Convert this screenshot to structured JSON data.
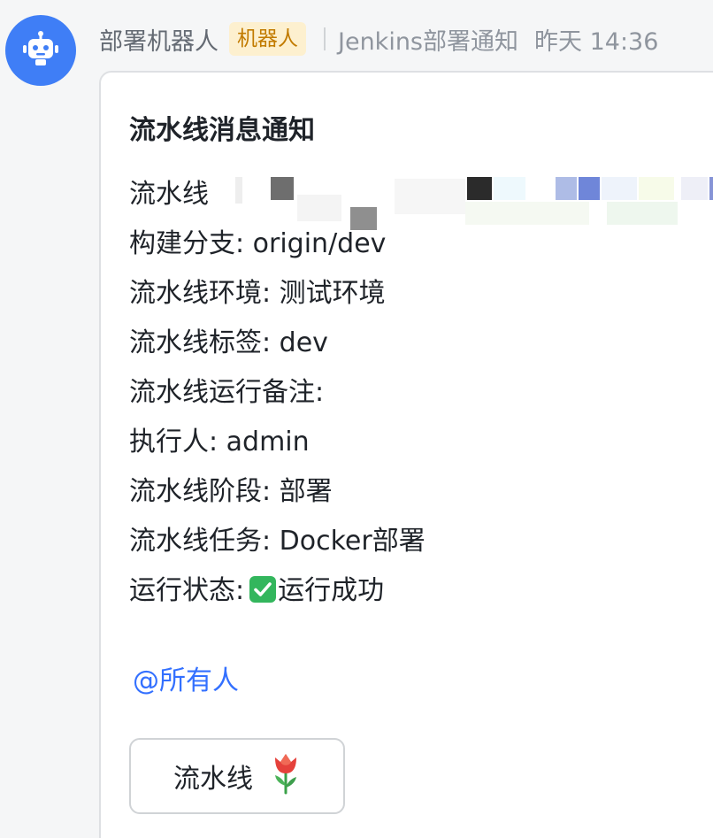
{
  "message": {
    "sender": "部署机器人",
    "badge": "机器人",
    "source": "Jenkins部署通知",
    "time": "昨天 14:36"
  },
  "card": {
    "title": "流水线消息通知",
    "pipeline_label": "流水线",
    "fields": [
      {
        "label": "构建分支",
        "value": "origin/dev"
      },
      {
        "label": "流水线环境",
        "value": "测试环境"
      },
      {
        "label": "流水线标签",
        "value": "dev"
      },
      {
        "label": "流水线运行备注",
        "value": ""
      },
      {
        "label": "执行人",
        "value": "admin"
      },
      {
        "label": "流水线阶段",
        "value": "部署"
      },
      {
        "label": "流水线任务",
        "value": "Docker部署"
      },
      {
        "label": "运行状态",
        "value": "运行成功"
      }
    ],
    "mention": "@所有人",
    "button_label": "流水线"
  },
  "colors": {
    "avatar_bg": "#3f7ef6",
    "badge_bg": "#fdf0cf",
    "badge_text": "#c27b00",
    "link": "#3370ff",
    "success": "#33b65d"
  },
  "icons": {
    "avatar": "robot-icon",
    "status": "check-mark-icon",
    "button": "tulip-icon"
  }
}
